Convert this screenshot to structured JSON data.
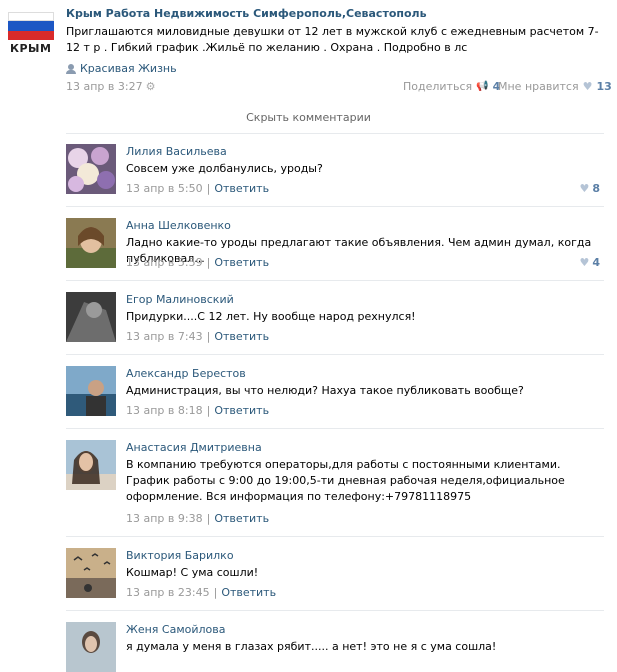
{
  "post": {
    "flag_label": "КРЫМ",
    "group_name": "Крым Работа Недвижимость Симферополь,Севастополь",
    "text": "Приглашаются миловидные девушки от 12 лет в мужской клуб с ежедневным расчетом 7-12 т р . Гибкий график .Жильё по желанию . Охрана . Подробно в лс",
    "signer": "Красивая Жизнь",
    "date": "13 апр в 3:27",
    "share_label": "Поделиться",
    "share_count": "4",
    "like_label": "Мне нравится",
    "like_count": "13",
    "hide_comments": "Скрыть комментарии"
  },
  "comments": [
    {
      "author": "Лилия Васильева",
      "text": "Совсем уже долбанулись, уроды?",
      "date": "13 апр в 5:50",
      "reply": "Ответить",
      "likes": "8"
    },
    {
      "author": "Анна Шелковенко",
      "text": "Ладно какие-то уроды предлагают такие объявления. Чем админ думал, когда публиковал...",
      "date": "13 апр в 5:59",
      "reply": "Ответить",
      "likes": "4"
    },
    {
      "author": "Егор Малиновский",
      "text": "Придурки....С 12 лет. Ну вообще народ рехнулся!",
      "date": "13 апр в 7:43",
      "reply": "Ответить",
      "likes": ""
    },
    {
      "author": "Александр Берестов",
      "text": "Администрация, вы что нелюди? Нахуа такое публиковать вообще?",
      "date": "13 апр в 8:18",
      "reply": "Ответить",
      "likes": ""
    },
    {
      "author": "Анастасия Дмитриевна",
      "text": "В компанию требуются операторы,для работы с постоянными клиентами. График работы с 9:00 до 19:00,5-ти дневная рабочая неделя,официальное оформление. Вся информация по телефону:+79781118975",
      "date": "13 апр в 9:38",
      "reply": "Ответить",
      "likes": ""
    },
    {
      "author": "Виктория Барилко",
      "text": "Кошмар! С ума сошли!",
      "date": "13 апр в 23:45",
      "reply": "Ответить",
      "likes": ""
    },
    {
      "author": "Женя Самойлова",
      "text": "я думала у меня в глазах рябит..... а нет! это не я с ума сошла!",
      "date": "",
      "reply": "",
      "likes": ""
    }
  ],
  "icons": {
    "signer": "user-icon",
    "gear": "gear-icon",
    "share": "megaphone-icon",
    "like": "heart-icon"
  },
  "colors": {
    "link": "#2b587a",
    "muted": "#999999",
    "separator": "#e7eaed"
  }
}
